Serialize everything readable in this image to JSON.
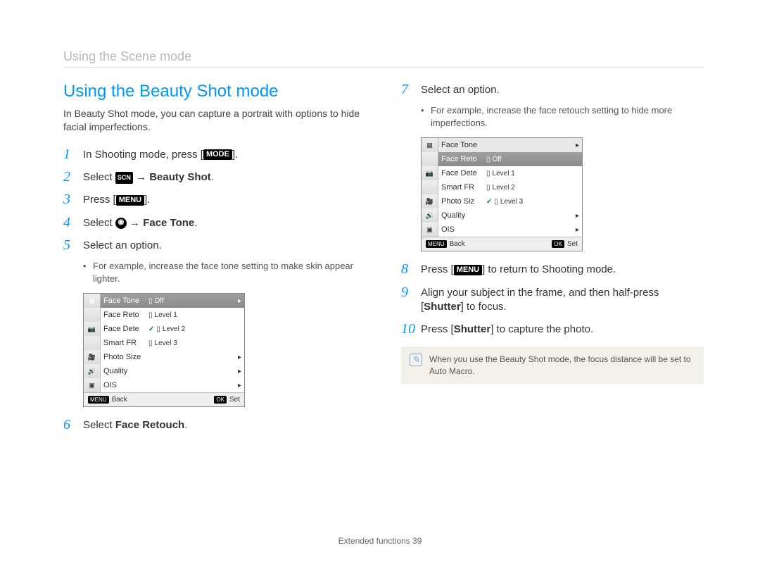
{
  "header": "Using the Scene mode",
  "title": "Using the Beauty Shot mode",
  "intro": "In Beauty Shot mode, you can capture a portrait with options to hide facial imperfections.",
  "buttons": {
    "mode": "MODE",
    "menu": "MENU",
    "scn": "SCN",
    "ok": "OK"
  },
  "steps_left": {
    "s1": {
      "pre": "In Shooting mode, press [",
      "post": "]."
    },
    "s2": {
      "pre": "Select ",
      "arrow": " → ",
      "bold": "Beauty Shot",
      "post": "."
    },
    "s3": {
      "pre": "Press [",
      "post": "]."
    },
    "s4": {
      "pre": "Select ",
      "arrow": " → ",
      "bold": "Face Tone",
      "post": "."
    },
    "s5": {
      "text": "Select an option."
    },
    "s5_sub": "For example, increase the face tone setting to make skin appear lighter.",
    "s6": {
      "pre": "Select ",
      "bold": "Face Retouch",
      "post": "."
    }
  },
  "steps_right": {
    "s7": {
      "text": "Select an option."
    },
    "s7_sub": "For example, increase the face retouch setting to hide more imperfections.",
    "s8": {
      "pre": "Press [",
      "post": "] to return to Shooting mode."
    },
    "s9": {
      "pre": "Align your subject in the frame, and then half-press [",
      "bold": "Shutter",
      "post": "] to focus."
    },
    "s10": {
      "pre": "Press [",
      "bold": "Shutter",
      "post": "] to capture the photo."
    }
  },
  "note": "When you use the Beauty Shot mode, the focus distance will be set to Auto Macro.",
  "shot1": {
    "rows": [
      {
        "side": "▦",
        "label": "Face Tone",
        "val_icon": "",
        "val": "Off",
        "tail": "▸",
        "sel": true
      },
      {
        "side": "",
        "label": "Face Reto",
        "val_icon": "",
        "val": "Level 1",
        "tail": ""
      },
      {
        "side": "📷",
        "label": "Face Dete",
        "val_icon": "✓",
        "val": "Level 2",
        "tail": "",
        "sel_val": true
      },
      {
        "side": "",
        "label": "Smart FR",
        "val_icon": "",
        "val": "Level 3",
        "tail": ""
      },
      {
        "side": "🎥",
        "label": "Photo Size",
        "val_icon": "",
        "val": "",
        "tail": "▸"
      },
      {
        "side": "🔊",
        "label": "Quality",
        "val_icon": "",
        "val": "",
        "tail": "▸"
      },
      {
        "side": "▣",
        "label": "OIS",
        "val_icon": "",
        "val": "",
        "tail": "▸"
      }
    ],
    "foot_left": "Back",
    "foot_right": "Set",
    "foot_left_btn": "MENU",
    "foot_right_btn": "OK"
  },
  "shot2": {
    "rows": [
      {
        "side": "▦",
        "label": "Face Tone",
        "val_icon": "",
        "val": "",
        "tail": "▸",
        "title": true
      },
      {
        "side": "",
        "label": "Face Reto",
        "val_icon": "",
        "val": "Off",
        "tail": "",
        "sel": true
      },
      {
        "side": "📷",
        "label": "Face Dete",
        "val_icon": "",
        "val": "Level 1",
        "tail": ""
      },
      {
        "side": "",
        "label": "Smart FR",
        "val_icon": "",
        "val": "Level 2",
        "tail": ""
      },
      {
        "side": "🎥",
        "label": "Photo Siz",
        "val_icon": "✓",
        "val": "Level 3",
        "tail": "",
        "sel_val": true
      },
      {
        "side": "🔊",
        "label": "Quality",
        "val_icon": "",
        "val": "",
        "tail": "▸"
      },
      {
        "side": "▣",
        "label": "OIS",
        "val_icon": "",
        "val": "",
        "tail": "▸"
      }
    ],
    "foot_left": "Back",
    "foot_right": "Set",
    "foot_left_btn": "MENU",
    "foot_right_btn": "OK"
  },
  "footer": {
    "label": "Extended functions",
    "page": "39"
  }
}
